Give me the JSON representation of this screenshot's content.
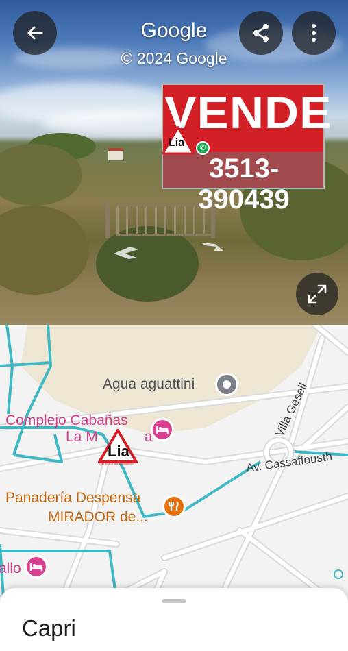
{
  "header": {
    "title": "Google",
    "copyright": "© 2024 Google",
    "back_icon": "arrow-left-icon",
    "share_icon": "share-icon",
    "menu_icon": "more-vert-icon"
  },
  "street_view": {
    "expand_icon": "fullscreen-icon",
    "sign": {
      "headline": "VENDE",
      "phone": "3513-390439",
      "brand": "Lia",
      "whatsapp_icon": "whatsapp-icon"
    }
  },
  "map": {
    "labels": {
      "agua": "Agua aguattini",
      "complejo_1": "Complejo Cabañas",
      "complejo_2": "La M",
      "complejo_3": "a",
      "panaderia_1": "Panadería Despensa",
      "panaderia_2": "MIRADOR de...",
      "villa": "Villa Gesell",
      "avenue": "Av. Cassaffousth",
      "partial": "allo"
    },
    "marker_brand": "Lia",
    "marker_sub": "Servicios Inmobiliarios",
    "colors": {
      "road_highlight": "#3fb8c6",
      "poi_pink": "#d6408f",
      "poi_orange": "#e8710a"
    }
  },
  "sheet": {
    "place_name": "Capri"
  }
}
